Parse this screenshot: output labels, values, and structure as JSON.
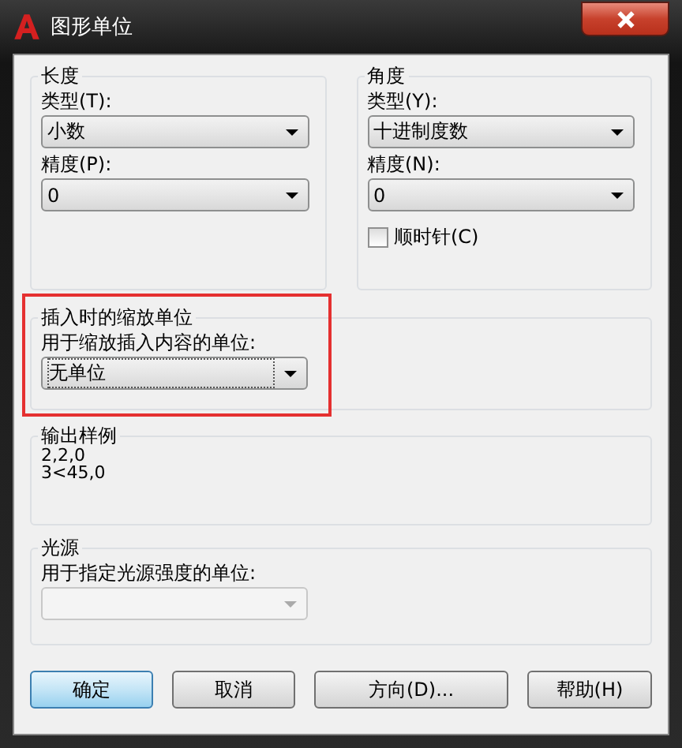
{
  "window": {
    "title": "图形单位"
  },
  "length": {
    "title": "长度",
    "type_label": "类型(T):",
    "type_value": "小数",
    "precision_label": "精度(P):",
    "precision_value": "0"
  },
  "angle": {
    "title": "角度",
    "type_label": "类型(Y):",
    "type_value": "十进制度数",
    "precision_label": "精度(N):",
    "precision_value": "0",
    "clockwise": {
      "label": "顺时针(C)",
      "checked": false
    }
  },
  "insertion": {
    "title": "插入时的缩放单位",
    "label": "用于缩放插入内容的单位:",
    "value": "无单位",
    "highlighted": true
  },
  "output": {
    "title": "输出样例",
    "lines": [
      "2,2,0",
      "3<45,0"
    ]
  },
  "lighting": {
    "title": "光源",
    "label": "用于指定光源强度的单位:",
    "disabled": true
  },
  "buttons": [
    {
      "label": "确定",
      "default": true
    },
    {
      "label": "取消",
      "default": false
    },
    {
      "label": "方向(D)...",
      "default": false
    },
    {
      "label": "帮助(H)",
      "default": false
    }
  ]
}
